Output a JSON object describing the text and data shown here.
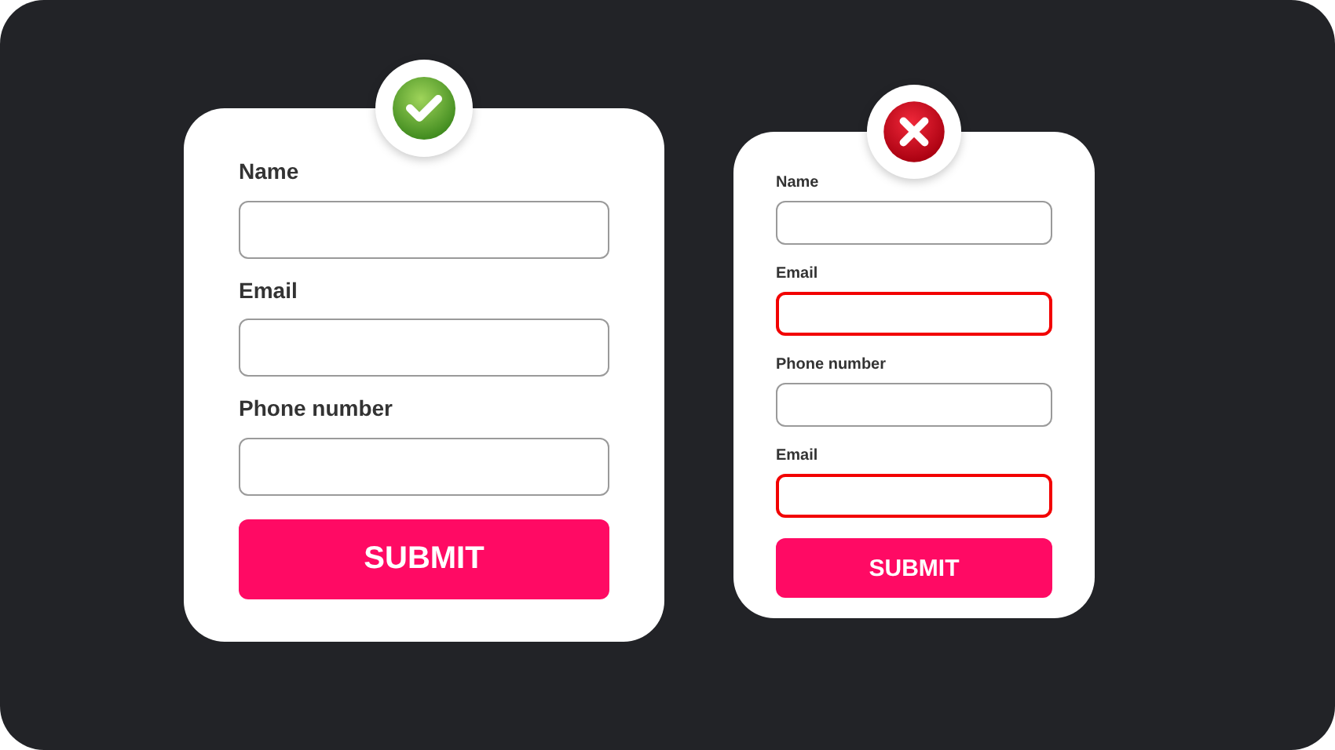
{
  "forms": [
    {
      "kind": "large",
      "valid": true,
      "fields": [
        {
          "label": "Name",
          "error": false
        },
        {
          "label": "Email",
          "error": false
        },
        {
          "label": "Phone number",
          "error": false
        }
      ],
      "submit": "SUBMIT"
    },
    {
      "kind": "small",
      "valid": false,
      "fields": [
        {
          "label": "Name",
          "error": false
        },
        {
          "label": "Email",
          "error": true
        },
        {
          "label": "Phone number",
          "error": false
        },
        {
          "label": "Email",
          "error": true
        }
      ],
      "submit": "SUBMIT"
    }
  ]
}
